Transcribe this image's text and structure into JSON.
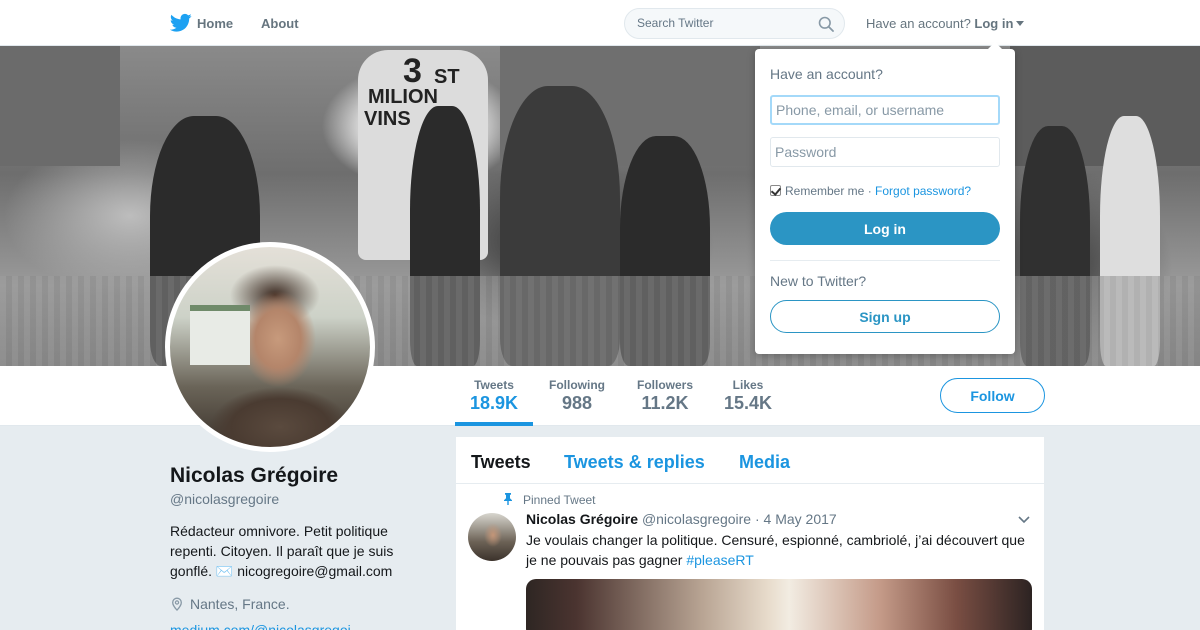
{
  "colors": {
    "accent": "#1b95e0",
    "login_button": "#2b95c4",
    "text_primary": "#14171a",
    "text_secondary": "#657786"
  },
  "icons": {
    "brand": "twitter-bird-icon",
    "search": "search-icon",
    "location": "location-pin-icon",
    "pinned": "pin-icon",
    "chevron": "chevron-down-icon",
    "caret": "caret-down-icon"
  },
  "nav": {
    "home": "Home",
    "about": "About",
    "search_placeholder": "Search Twitter",
    "have_account": "Have an account?",
    "login": "Log in"
  },
  "login_dropdown": {
    "title": "Have an account?",
    "username_placeholder": "Phone, email, or username",
    "password_placeholder": "Password",
    "remember_me": "Remember me",
    "separator": "·",
    "forgot_password": "Forgot password?",
    "remember_checked": true,
    "login_button": "Log in",
    "new_to_twitter": "New to Twitter?",
    "signup_button": "Sign up"
  },
  "banner": {
    "sign_line1": "3",
    "sign_line1b": "ST",
    "sign_line2": "MILION",
    "sign_line3": "VINS"
  },
  "profile": {
    "name": "Nicolas Grégoire",
    "handle": "@nicolasgregoire",
    "bio": "Rédacteur omnivore. Petit politique repenti. Citoyen. Il paraît que je suis gonflé. ✉️ nicogregoire@gmail.com",
    "location": "Nantes, France.",
    "link": "medium.com/@nicolasgregoi..."
  },
  "stats": [
    {
      "label": "Tweets",
      "value": "18.9K"
    },
    {
      "label": "Following",
      "value": "988"
    },
    {
      "label": "Followers",
      "value": "11.2K"
    },
    {
      "label": "Likes",
      "value": "15.4K"
    }
  ],
  "follow_button": "Follow",
  "timeline": {
    "tabs": [
      "Tweets",
      "Tweets & replies",
      "Media"
    ],
    "pinned_label": "Pinned Tweet",
    "tweet": {
      "author": "Nicolas Grégoire",
      "handle": "@nicolasgregoire",
      "date": "· 4 May 2017",
      "text": "Je voulais changer la politique. Censuré, espionné, cambriolé, j’ai découvert que je ne pouvais pas gagner",
      "hashtag": "#pleaseRT"
    }
  }
}
